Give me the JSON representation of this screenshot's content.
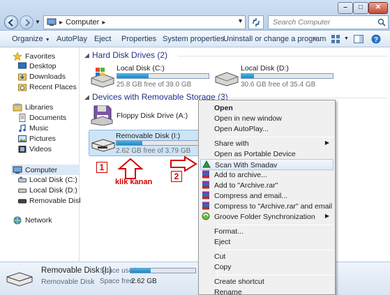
{
  "address": {
    "path": [
      "Computer"
    ]
  },
  "search": {
    "placeholder": "Search Computer"
  },
  "toolbar": {
    "organize": "Organize",
    "autoplay": "AutoPlay",
    "eject": "Eject",
    "properties": "Properties",
    "system_properties": "System properties",
    "uninstall": "Uninstall or change a program"
  },
  "sidebar": {
    "favorites": "Favorites",
    "desktop": "Desktop",
    "downloads": "Downloads",
    "recent": "Recent Places",
    "libraries": "Libraries",
    "documents": "Documents",
    "music": "Music",
    "pictures": "Pictures",
    "videos": "Videos",
    "computer": "Computer",
    "local_c": "Local Disk (C:)",
    "local_d": "Local Disk (D:)",
    "removable": "Removable Disk (I:)",
    "network": "Network"
  },
  "groups": {
    "hdd": "Hard Disk Drives (2)",
    "removable": "Devices with Removable Storage (3)"
  },
  "drives": {
    "c": {
      "name": "Local Disk (C:)",
      "space": "25.8 GB free of 39.0 GB",
      "used_fraction": 0.34
    },
    "d": {
      "name": "Local Disk (D:)",
      "space": "30.6 GB free of 35.4 GB",
      "used_fraction": 0.14
    },
    "floppy": {
      "name": "Floppy Disk Drive (A:)"
    },
    "removable": {
      "name": "Removable Disk (I:)",
      "space": "2.62 GB free of 3.79 GB",
      "used_fraction": 0.31
    }
  },
  "details": {
    "name": "Removable Disk (I:)",
    "type": "Removable Disk",
    "space_used_label": "Space used:",
    "space_free_label": "Space free:",
    "space_free": "2.62 GB",
    "used_fraction": 0.31
  },
  "annotations": {
    "step1": "1",
    "step2": "2",
    "caption": "klik kanan"
  },
  "context_menu": {
    "open": "Open",
    "open_new_window": "Open in new window",
    "open_autoplay": "Open AutoPlay...",
    "share_with": "Share with",
    "open_portable": "Open as Portable Device",
    "scan_smadav": "Scan With Smadav",
    "add_archive": "Add to archive...",
    "add_rar": "Add to \"Archive.rar\"",
    "compress_email": "Compress and email...",
    "compress_rar_email": "Compress to \"Archive.rar\" and email",
    "groove": "Groove Folder Synchronization",
    "format": "Format...",
    "eject": "Eject",
    "cut": "Cut",
    "copy": "Copy",
    "create_shortcut": "Create shortcut",
    "rename": "Rename"
  },
  "colors": {
    "accent": "#1f86c3",
    "annotation": "#d10000",
    "group_title": "#1e3287"
  }
}
